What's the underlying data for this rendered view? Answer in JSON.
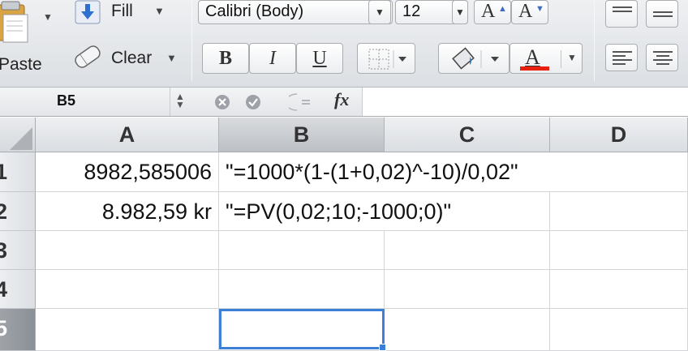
{
  "ribbon": {
    "paste_label": "Paste",
    "fill_label": "Fill",
    "clear_label": "Clear",
    "font_name": "Calibri (Body)",
    "font_size": "12",
    "bold_label": "B",
    "italic_label": "I",
    "underline_label": "U",
    "grow_label": "A",
    "shrink_label": "A",
    "fontcolor_label": "A",
    "fontcolor_color": "#e8200f"
  },
  "formula_bar": {
    "name_box": "B5",
    "formula": ""
  },
  "grid": {
    "columns": [
      "A",
      "B",
      "C",
      "D"
    ],
    "rows": [
      "1",
      "2",
      "3",
      "4",
      "5"
    ],
    "cells": {
      "A1": "8982,585006",
      "B1": "\"=1000*(1-(1+0,02)^-10)/0,02\"",
      "A2": "8.982,59 kr",
      "B2": "\"=PV(0,02;10;-1000;0)\""
    },
    "selected_cell": "B5",
    "accent_color": "#3b7fd6"
  }
}
